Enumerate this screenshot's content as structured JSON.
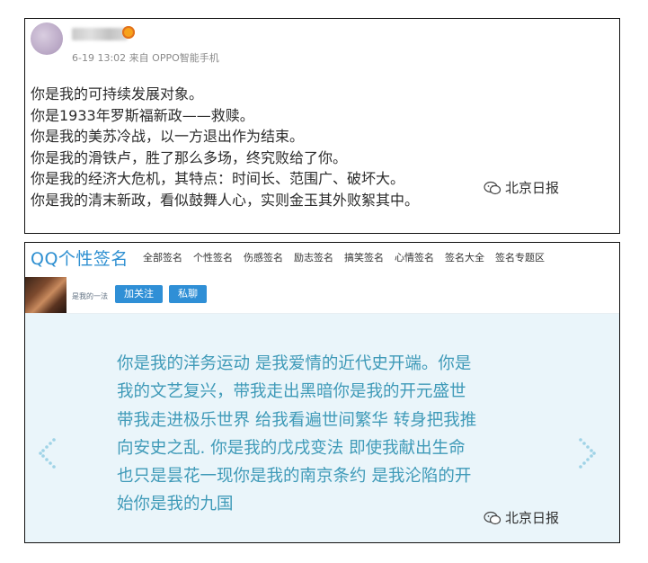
{
  "post": {
    "meta": "6-19 13:02 来自 OPPO智能手机",
    "lines": [
      "你是我的可持续发展对象。",
      "你是1933年罗斯福新政——救赎。",
      "你是我的美苏冷战，以一方退出作为结束。",
      "你是我的滑铁卢，胜了那么多场，终究败给了你。",
      "你是我的经济大危机，其特点：时间长、范围广、破坏大。",
      "你是我的清末新政，看似鼓舞人心，实则金玉其外败絮其中。"
    ]
  },
  "watermark": {
    "text": "北京日报"
  },
  "qq": {
    "site_name": "QQ个性签名",
    "nav": [
      "全部签名",
      "个性签名",
      "伤感签名",
      "励志签名",
      "搞笑签名",
      "心情签名",
      "签名大全",
      "签名专题区"
    ],
    "user_name": "是我的一法",
    "follow_label": "加关注",
    "message_label": "私聊",
    "signature_lines": [
      "你是我的洋务运动 是我爱情的近代史开端。你是",
      "我的文艺复兴，带我走出黑暗你是我的开元盛世",
      "带我走进极乐世界 给我看遍世间繁华 转身把我推",
      "向安史之乱. 你是我的戊戌变法 即使我献出生命",
      "也只是昙花一现你是我的南京条约 是我沦陷的开",
      "始你是我的九国"
    ]
  },
  "colors": {
    "brand_blue": "#2d8fd1",
    "button_blue": "#2f8fd6",
    "signature_text": "#3f9ab8",
    "content_bg": "#eaf5fa"
  }
}
